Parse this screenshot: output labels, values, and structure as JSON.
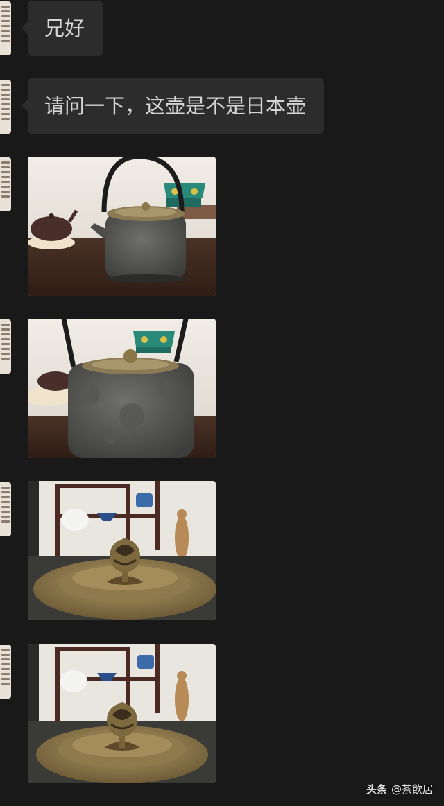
{
  "messages": [
    {
      "type": "text",
      "text": "兄好"
    },
    {
      "type": "text",
      "text": "请问一下，这壶是不是日本壶"
    },
    {
      "type": "image",
      "subject": "iron-teapot-full"
    },
    {
      "type": "image",
      "subject": "iron-teapot-closeup"
    },
    {
      "type": "image",
      "subject": "teapot-lid-knob"
    },
    {
      "type": "image",
      "subject": "teapot-lid-knob-closeup"
    }
  ],
  "watermark": {
    "brand": "头条",
    "account": "@茶飲居"
  },
  "colors": {
    "background": "#191919",
    "bubble": "#2c2c2c",
    "bubble_text": "#d6d6d6"
  }
}
